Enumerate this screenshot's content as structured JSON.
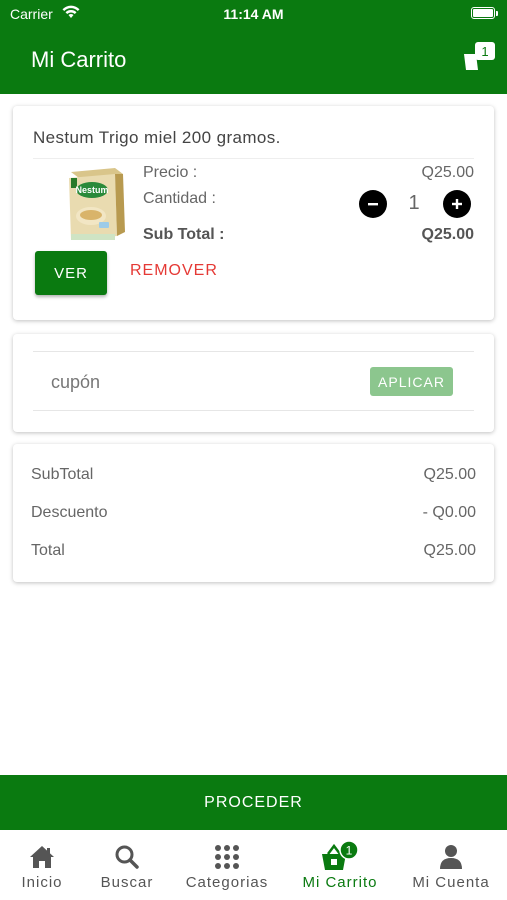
{
  "status_bar": {
    "carrier": "Carrier",
    "time": "11:14 AM"
  },
  "header": {
    "title": "Mi Carrito",
    "cart_count": "1"
  },
  "product": {
    "name": "Nestum Trigo miel 200 gramos.",
    "image_label": "Nestum",
    "price_label": "Precio :",
    "price_value": "Q25.00",
    "quantity_label": "Cantidad :",
    "quantity_value": "1",
    "subtotal_label": "Sub Total :",
    "subtotal_value": "Q25.00",
    "view_label": "VER",
    "remove_label": "REMOVER"
  },
  "coupon": {
    "placeholder": "cupón",
    "apply_label": "APLICAR"
  },
  "totals": {
    "rows": [
      {
        "label": "SubTotal",
        "value": "Q25.00"
      },
      {
        "label": "Descuento",
        "value": "- Q0.00"
      },
      {
        "label": "Total",
        "value": "Q25.00"
      }
    ]
  },
  "proceed_label": "PROCEDER",
  "tabs": [
    {
      "label": "Inicio",
      "icon": "home-icon"
    },
    {
      "label": "Buscar",
      "icon": "search-icon"
    },
    {
      "label": "Categorias",
      "icon": "grid-icon"
    },
    {
      "label": "Mi Carrito",
      "icon": "cart-icon",
      "badge": "1",
      "active": true
    },
    {
      "label": "Mi Cuenta",
      "icon": "user-icon"
    }
  ],
  "colors": {
    "primary": "#0a7a10",
    "remove": "#e53935",
    "apply_button": "#8cc68e"
  }
}
